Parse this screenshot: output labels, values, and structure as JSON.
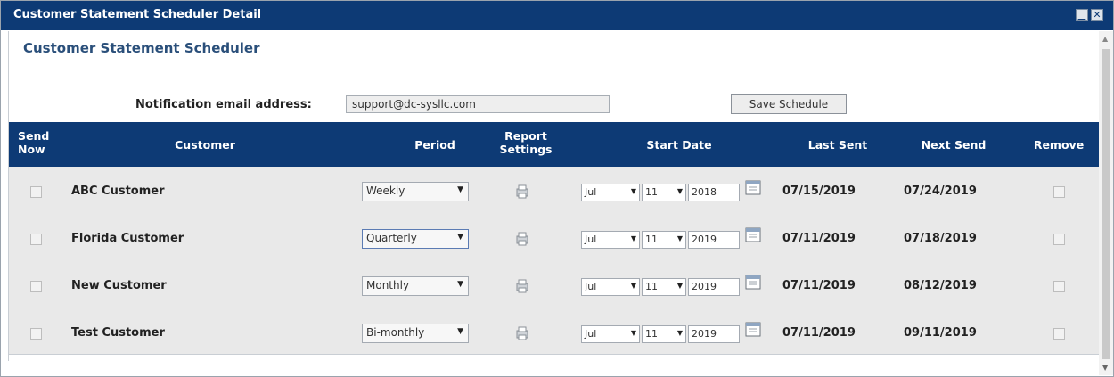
{
  "window": {
    "title": "Customer Statement Scheduler Detail",
    "minimize_icon": "minimize-icon",
    "close_icon": "close-icon",
    "close_glyph": "✕"
  },
  "heading": "Customer Statement Scheduler",
  "notification": {
    "label": "Notification email address:",
    "value": "support@dc-sysllc.com"
  },
  "save_label": "Save Schedule",
  "columns": {
    "send_now": [
      "Send",
      "Now"
    ],
    "customer": "Customer",
    "period": "Period",
    "report_settings": [
      "Report",
      "Settings"
    ],
    "start_date": "Start Date",
    "last_sent": "Last Sent",
    "next_send": "Next Send",
    "remove": "Remove"
  },
  "rows": [
    {
      "customer": "ABC Customer",
      "period": "Weekly",
      "month": "Jul",
      "day": "11",
      "year": "2018",
      "last_sent": "07/15/2019",
      "next_send": "07/24/2019"
    },
    {
      "customer": "Florida Customer",
      "period": "Quarterly",
      "month": "Jul",
      "day": "11",
      "year": "2019",
      "last_sent": "07/11/2019",
      "next_send": "07/18/2019"
    },
    {
      "customer": "New Customer",
      "period": "Monthly",
      "month": "Jul",
      "day": "11",
      "year": "2019",
      "last_sent": "07/11/2019",
      "next_send": "08/12/2019"
    },
    {
      "customer": "Test Customer",
      "period": "Bi-monthly",
      "month": "Jul",
      "day": "11",
      "year": "2019",
      "last_sent": "07/11/2019",
      "next_send": "09/11/2019"
    }
  ],
  "icons": {
    "report": "report-settings-icon",
    "calendar": "calendar-icon",
    "dropdown": "chevron-down-icon"
  },
  "colors": {
    "header_bg": "#0d3a75",
    "heading_text": "#2a4f7a",
    "table_body": "#e9e9e9"
  }
}
